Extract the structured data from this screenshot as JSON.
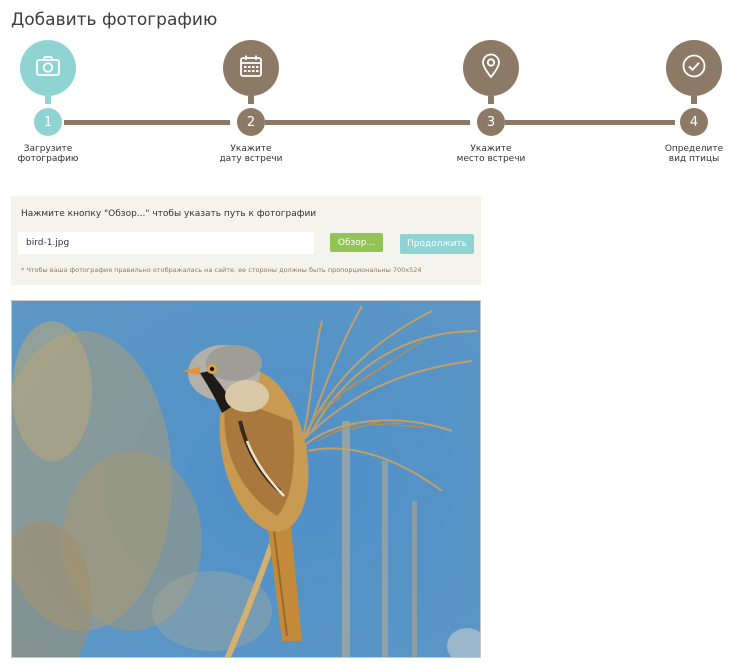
{
  "page": {
    "title": "Добавить фотографию"
  },
  "steps": [
    {
      "number": "1",
      "label": "Загрузите\nфотографию",
      "icon": "camera-icon",
      "active": true
    },
    {
      "number": "2",
      "label": "Укажите\nдату встречи",
      "icon": "calendar-icon",
      "active": false
    },
    {
      "number": "3",
      "label": "Укажите\nместо встречи",
      "icon": "location-pin-icon",
      "active": false
    },
    {
      "number": "4",
      "label": "Определите\nвид птицы",
      "icon": "checkmark-icon",
      "active": false
    }
  ],
  "colors": {
    "active": "#8fd3d3",
    "inactive": "#8c7a66",
    "browse": "#93c354",
    "panel_bg": "#f5f4ec"
  },
  "upload": {
    "instruction": "Нажмите кнопку \"Обзор...\" чтобы указать путь к фотографии",
    "file_value": "bird-1.jpg",
    "browse_label": "Обзор...",
    "continue_label": "Продолжить",
    "note": "* Чтобы ваша фотография правильно отображалась на сайте, ее стороны должны быть пропорциональны 700x524"
  }
}
